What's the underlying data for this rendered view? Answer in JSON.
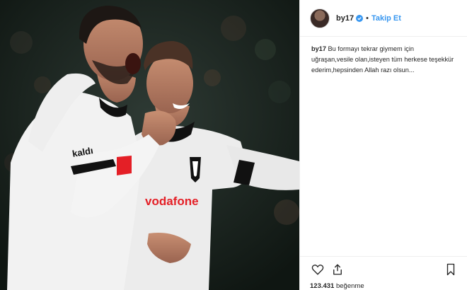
{
  "post": {
    "username": "by17",
    "separator": "•",
    "follow_label": "Takip Et",
    "caption_username": "by17",
    "caption_text": "Bu formayı tekrar giymem için uğraşan,vesile olan,isteyen tüm herkese teşekkür ederim,hepsinden Allah razı olsun...",
    "likes_count": "123.431",
    "likes_label": "beğenme"
  },
  "photo": {
    "sponsor_text": "vodafone",
    "sleeve_text": "kaldı",
    "accent_red": "#e41f26",
    "jersey_white": "#f2f2f2"
  },
  "colors": {
    "link_blue": "#3897f0",
    "verified_blue": "#3897f0",
    "text": "#262626",
    "border": "#efefef"
  }
}
